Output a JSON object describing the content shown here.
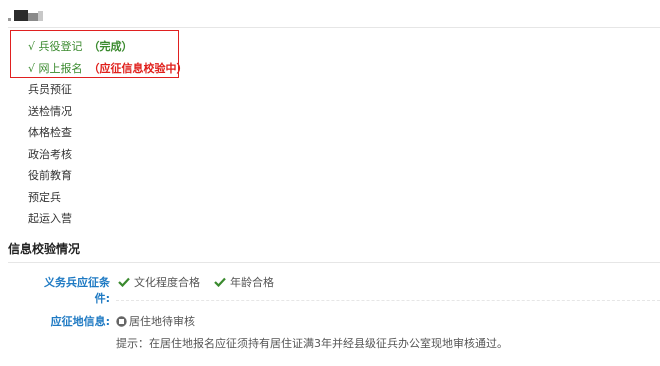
{
  "steps": [
    {
      "label": "√ 兵役登记",
      "note": "（完成）",
      "state": "done"
    },
    {
      "label": "√ 网上报名",
      "note": "（应征信息校验中）",
      "state": "checking"
    },
    {
      "label": "兵员预征"
    },
    {
      "label": "送检情况"
    },
    {
      "label": "体格检查"
    },
    {
      "label": "政治考核"
    },
    {
      "label": "役前教育"
    },
    {
      "label": "预定兵"
    },
    {
      "label": "起运入营"
    }
  ],
  "verification": {
    "title": "信息校验情况",
    "conditions_label": "义务兵应征条件:",
    "conditions": [
      "文化程度合格",
      "年龄合格"
    ],
    "location_label": "应征地信息:",
    "location_status": "居住地待审核",
    "hint": "提示：在居住地报名应征须持有居住证满3年并经县级征兵办公室现地审核通过。"
  },
  "colors": {
    "accent_green": "#3a8a2e",
    "alert_red": "#e0201c",
    "label_blue": "#1f7ac3"
  }
}
